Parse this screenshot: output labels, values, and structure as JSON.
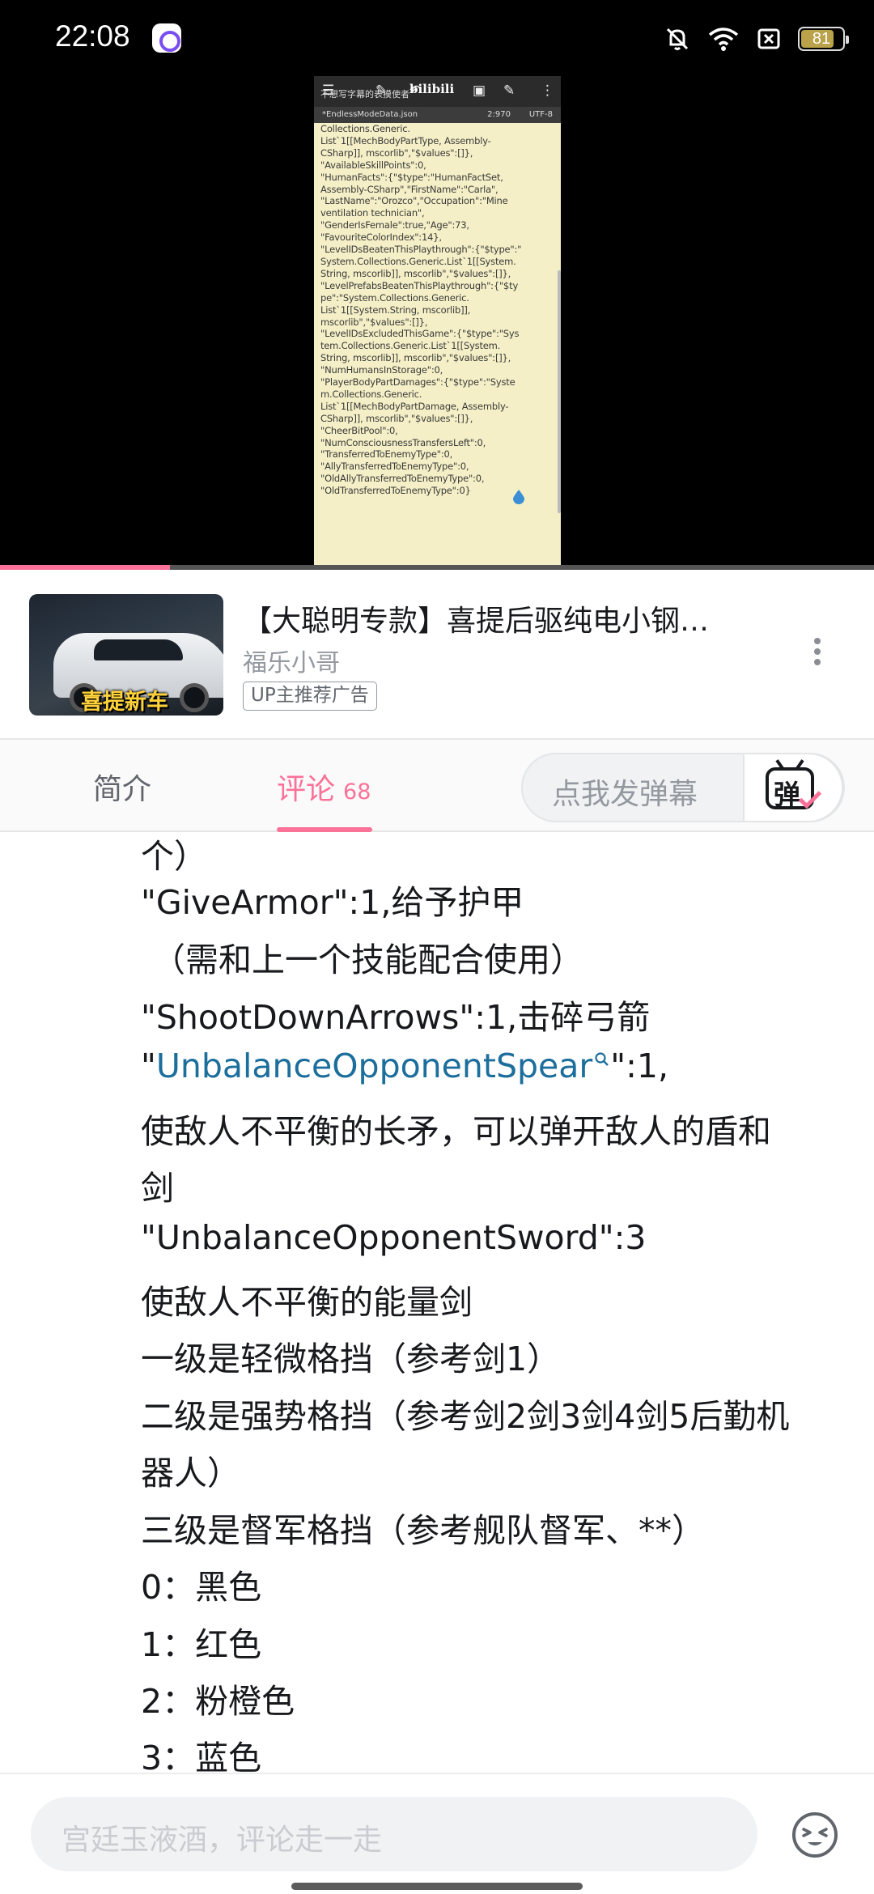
{
  "status_bar": {
    "time": "22:08",
    "battery": "81",
    "battery_level": 0.81,
    "icons": [
      "app-icon",
      "silent-bell-icon",
      "wifi-icon",
      "sim-off-icon",
      "battery-icon"
    ]
  },
  "video_frame": {
    "toolbar_text": "不想写字幕的表摸使者",
    "logo": "bilibili",
    "file_name": "*EndlessModeData.json",
    "cursor_pos": "2:970",
    "encoding": "UTF-8",
    "code_lines": [
      "Collections.Generic.",
      "List`1[[MechBodyPartType, Assembly-",
      "CSharp]], mscorlib\",\"$values\":[]},",
      "\"AvailableSkillPoints\":0,",
      "\"HumanFacts\":{\"$type\":\"HumanFactSet,",
      "Assembly-CSharp\",\"FirstName\":\"Carla\",",
      "\"LastName\":\"Orozco\",\"Occupation\":\"Mine",
      "ventilation technician\",",
      "\"GenderIsFemale\":true,\"Age\":73,",
      "\"FavouriteColorIndex\":14},",
      "\"LevelIDsBeatenThisPlaythrough\":{\"$type\":\"",
      "System.Collections.Generic.List`1[[System.",
      "String, mscorlib]], mscorlib\",\"$values\":[]},",
      "\"LevelPrefabsBeatenThisPlaythrough\":{\"$ty",
      "pe\":\"System.Collections.Generic.",
      "List`1[[System.String, mscorlib]],",
      "mscorlib\",\"$values\":[]},",
      "\"LevelIDsExcludedThisGame\":{\"$type\":\"Sys",
      "tem.Collections.Generic.List`1[[System.",
      "String, mscorlib]], mscorlib\",\"$values\":[]},",
      "\"NumHumansInStorage\":0,",
      "\"PlayerBodyPartDamages\":{\"$type\":\"Syste",
      "m.Collections.Generic.",
      "List`1[[MechBodyPartDamage, Assembly-",
      "CSharp]], mscorlib\",\"$values\":[]},",
      "\"CheerBitPool\":0,",
      "\"NumConsciousnessTransfersLeft\":0,",
      "\"TransferredToEnemyType\":0,",
      "\"AllyTransferredToEnemyType\":0,",
      "\"OldAllyTransferredToEnemyType\":0,",
      "\"OldTransferredToEnemyType\":0}"
    ],
    "progress": 0.194
  },
  "ad": {
    "title": "【大聪明专款】喜提后驱纯电小钢…",
    "author": "福乐小哥",
    "tag": "UP主推荐广告",
    "thumb_label": "喜提新车"
  },
  "tabs": {
    "intro": "简介",
    "comments": "评论",
    "comments_count": "68",
    "danmaku_placeholder": "点我发弹幕",
    "danmaku_button": "弹"
  },
  "comment": {
    "lines": [
      "个）",
      "\"GiveArmor\":1,给予护甲",
      "（需和上一个技能配合使用）",
      "\"ShootDownArrows\":1,击碎弓箭",
      "",
      "使敌人不平衡的长矛，可以弹开敌人的盾和",
      "剑",
      "\"UnbalanceOpponentSword\":3",
      "使敌人不平衡的能量剑",
      "一级是轻微格挡（参考剑1）",
      "二级是强势格挡（参考剑2剑3剑4剑5后勤机",
      "器人）",
      "三级是督军格挡（参考舰队督军、**）",
      "0：黑色",
      "1：红色",
      "2：粉橙色",
      "3：蓝色"
    ],
    "link_line": {
      "prefix": "\"",
      "link_text": "UnbalanceOpponentSpear",
      "suffix": "\":1,"
    }
  },
  "bottom_bar": {
    "reply_placeholder": "宫廷玉液酒，评论走一走",
    "emoji_icon": "emoji-icon"
  },
  "colors": {
    "accent": "#fb7299",
    "link": "#1c6e9c",
    "text": "#18191c",
    "muted": "#9499a0"
  }
}
